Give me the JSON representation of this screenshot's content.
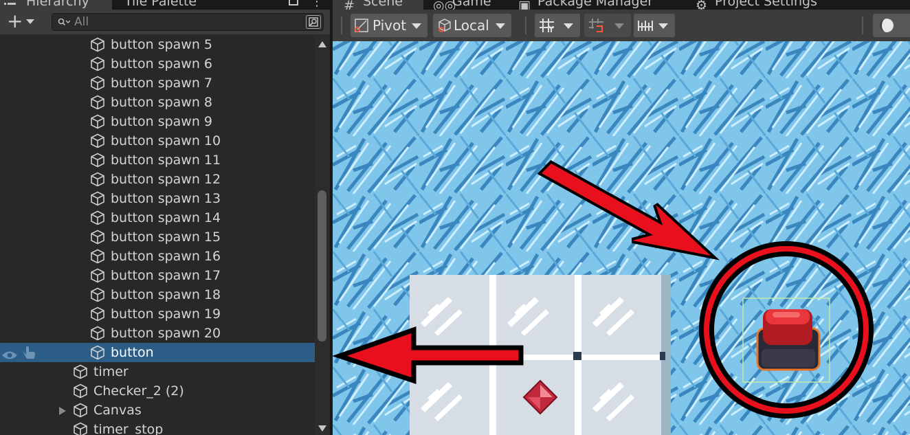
{
  "hierarchy_panel": {
    "tabs": [
      {
        "label": "Hierarchy",
        "icon": "hierarchy-icon",
        "active": true
      },
      {
        "label": "Tile Palette",
        "active": false
      }
    ],
    "toolbar": {
      "create_label": "+",
      "search_placeholder": "All",
      "search_value": ""
    },
    "rows": [
      {
        "label": "button spawn 5",
        "depth": 2
      },
      {
        "label": "button spawn 6",
        "depth": 2
      },
      {
        "label": "button spawn 7",
        "depth": 2
      },
      {
        "label": "button spawn 8",
        "depth": 2
      },
      {
        "label": "button spawn 9",
        "depth": 2
      },
      {
        "label": "button spawn 10",
        "depth": 2
      },
      {
        "label": "button spawn 11",
        "depth": 2
      },
      {
        "label": "button spawn 12",
        "depth": 2
      },
      {
        "label": "button spawn 13",
        "depth": 2
      },
      {
        "label": "button spawn 14",
        "depth": 2
      },
      {
        "label": "button spawn 15",
        "depth": 2
      },
      {
        "label": "button spawn 16",
        "depth": 2
      },
      {
        "label": "button spawn 17",
        "depth": 2
      },
      {
        "label": "button spawn 18",
        "depth": 2
      },
      {
        "label": "button spawn 19",
        "depth": 2
      },
      {
        "label": "button spawn 20",
        "depth": 2
      },
      {
        "label": "button",
        "depth": 2,
        "selected": true
      },
      {
        "label": "timer",
        "depth": 1
      },
      {
        "label": "Checker_2 (2)",
        "depth": 1
      },
      {
        "label": "Canvas",
        "depth": 1,
        "collapsed": true
      },
      {
        "label": "timer_stop",
        "depth": 1
      }
    ]
  },
  "scene_panel": {
    "tabs": [
      {
        "label": "Scene",
        "icon": "scene-grid-icon",
        "active": true
      },
      {
        "label": "Game",
        "icon": "gamepad-icon",
        "active": false
      },
      {
        "label": "Package Manager",
        "icon": "package-icon",
        "active": false
      },
      {
        "label": "Project Settings",
        "icon": "gear-icon",
        "active": false
      }
    ],
    "toolbar": {
      "pivot_label": "Pivot",
      "local_label": "Local"
    }
  },
  "colors": {
    "selection": "#2c5d87",
    "ice_water": "#7fc5e9",
    "floor_tile": "#d6dde5",
    "annotation_red": "#e8101c",
    "button_red": "#d42a2a"
  }
}
